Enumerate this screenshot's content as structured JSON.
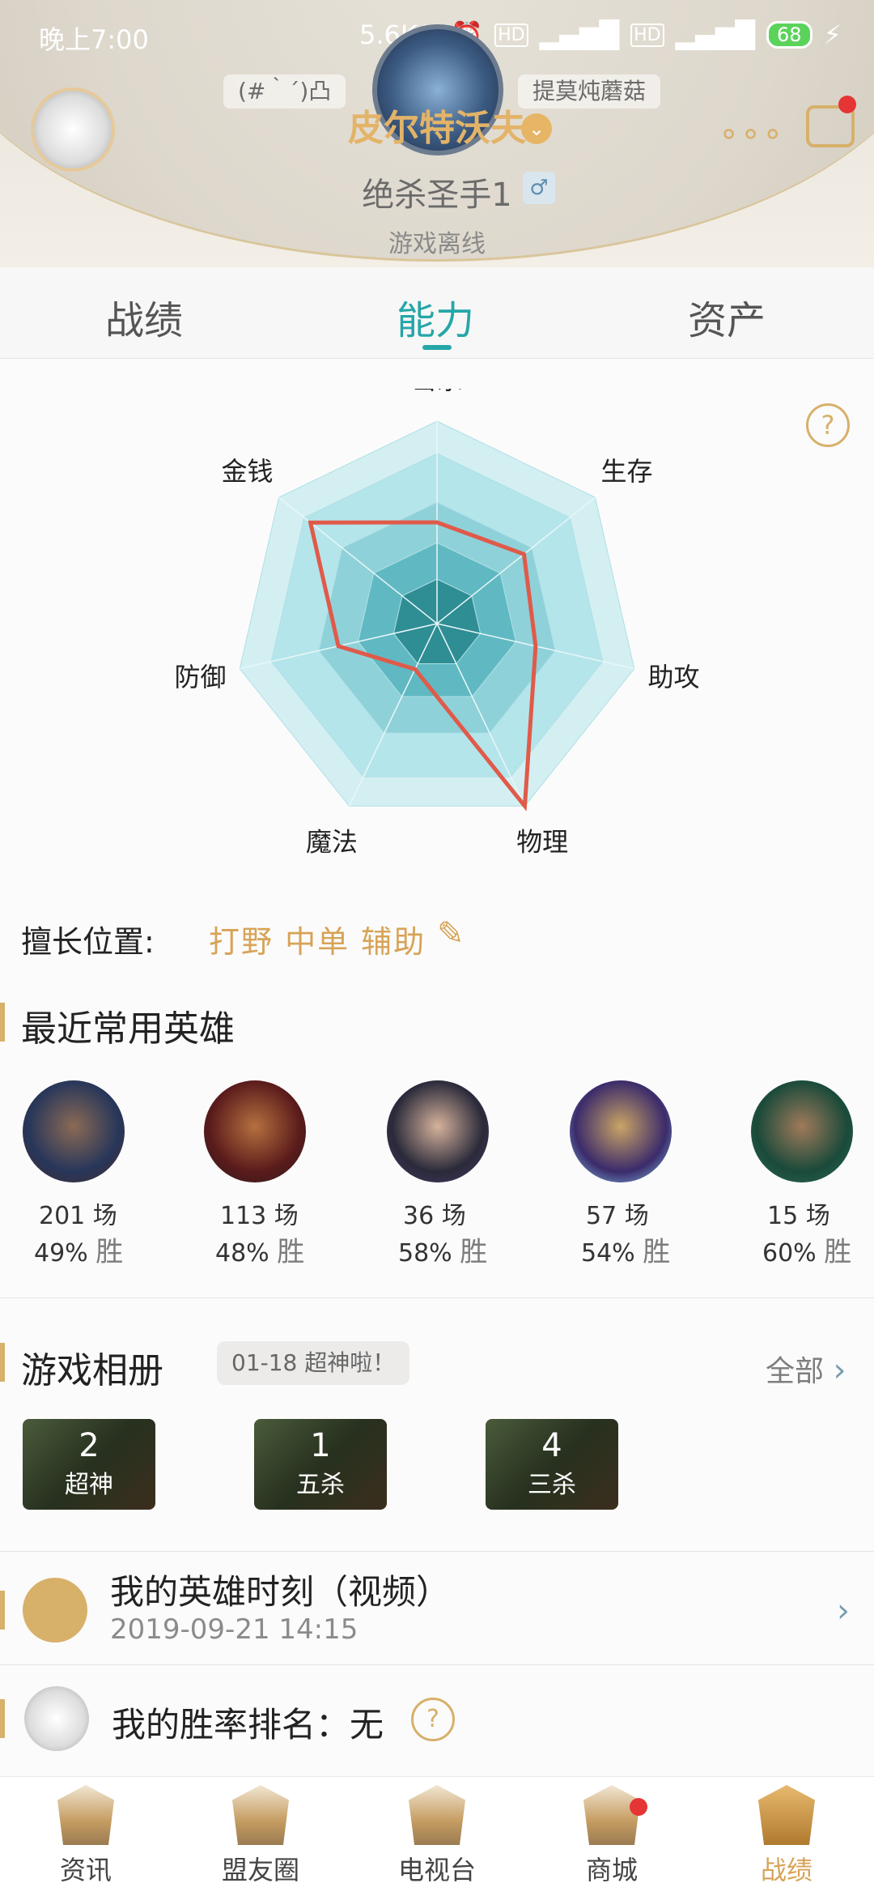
{
  "status_bar": {
    "time": "晚上7:00",
    "speed": "5.6K/s",
    "battery": "68"
  },
  "header": {
    "left_chip": "(#｀´)凸",
    "right_chip": "提莫炖蘑菇",
    "player_name": "皮尔特沃夫",
    "rank": "绝杀圣手1",
    "gender_symbol": "♂",
    "status": "游戏离线"
  },
  "tabs": [
    {
      "label": "战绩",
      "active": false
    },
    {
      "label": "能力",
      "active": true
    },
    {
      "label": "资产",
      "active": false
    }
  ],
  "radar": {
    "axes": [
      "击杀",
      "生存",
      "助攻",
      "物理",
      "魔法",
      "防御",
      "金钱"
    ],
    "values": [
      0.5,
      0.55,
      0.5,
      1.0,
      0.25,
      0.5,
      0.8
    ],
    "fill_colors": [
      "#d4eff2",
      "#b4e5ea",
      "#8fd1d9",
      "#60b9c2",
      "#2f8d94"
    ],
    "line_color": "#e05a4a"
  },
  "positions": {
    "label": "擅长位置:",
    "values": "打野 中单 辅助"
  },
  "heroes_section": {
    "title": "最近常用英雄",
    "heroes": [
      {
        "games": "201 场",
        "winrate": "49%",
        "win_label": "胜",
        "colors": [
          "#27365a",
          "#8b6a54",
          "#4a2b2b"
        ]
      },
      {
        "games": "113 场",
        "winrate": "48%",
        "win_label": "胜",
        "colors": [
          "#5a1b1b",
          "#b5703f",
          "#2b1c1c"
        ]
      },
      {
        "games": "36 场",
        "winrate": "58%",
        "win_label": "胜",
        "colors": [
          "#2a2a3a",
          "#d6b29c",
          "#4b3a6a"
        ]
      },
      {
        "games": "57 场",
        "winrate": "54%",
        "win_label": "胜",
        "colors": [
          "#3b2b6b",
          "#caa465",
          "#8ad0f5"
        ]
      },
      {
        "games": "15 场",
        "winrate": "60%",
        "win_label": "胜",
        "colors": [
          "#1a4a3a",
          "#a07a5a",
          "#2f6b5a"
        ]
      }
    ]
  },
  "album_section": {
    "title": "游戏相册",
    "chip": "01-18 超神啦！",
    "all_link": "全部",
    "cards": [
      {
        "num": "2",
        "label": "超神"
      },
      {
        "num": "1",
        "label": "五杀"
      },
      {
        "num": "4",
        "label": "三杀"
      }
    ]
  },
  "moment": {
    "title": "我的英雄时刻（视频）",
    "date": "2019-09-21 14:15"
  },
  "rank_row": {
    "text": "我的胜率排名：无"
  },
  "bottom_nav": [
    {
      "label": "资讯",
      "active": false,
      "dot": false
    },
    {
      "label": "盟友圈",
      "active": false,
      "dot": false
    },
    {
      "label": "电视台",
      "active": false,
      "dot": false
    },
    {
      "label": "商城",
      "active": false,
      "dot": true
    },
    {
      "label": "战绩",
      "active": true,
      "dot": false
    }
  ]
}
